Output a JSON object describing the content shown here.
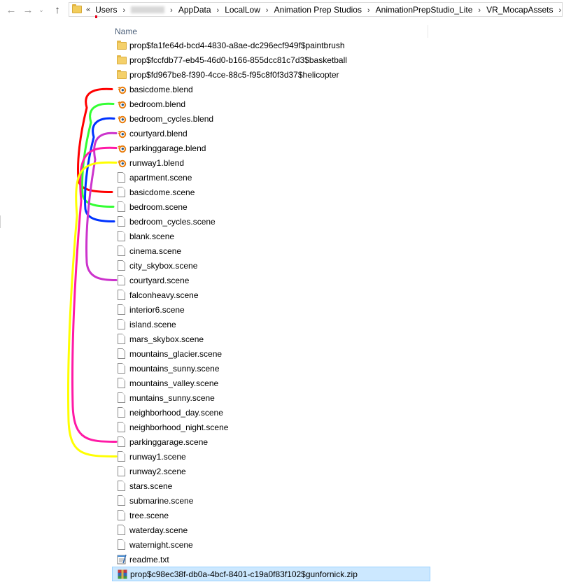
{
  "breadcrumb": {
    "overflow": "«",
    "segments": [
      {
        "label": "Users",
        "blurred": false
      },
      {
        "label": "",
        "blurred": true
      },
      {
        "label": "AppData",
        "blurred": false
      },
      {
        "label": "LocalLow",
        "blurred": false
      },
      {
        "label": "Animation Prep Studios",
        "blurred": false
      },
      {
        "label": "AnimationPrepStudio_Lite",
        "blurred": false
      },
      {
        "label": "VR_MocapAssets",
        "blurred": false,
        "current": true
      }
    ]
  },
  "nav": {
    "back_icon": "←",
    "forward_icon": "→",
    "recent_icon": "⌄",
    "up_icon": "↑",
    "separator": "›"
  },
  "list": {
    "column_header": "Name",
    "files": [
      {
        "name": "prop$fa1fe64d-bcd4-4830-a8ae-dc296ecf949f$paintbrush",
        "type": "folder"
      },
      {
        "name": "prop$fccfdb77-eb45-46d0-b166-855dcc81c7d3$basketball",
        "type": "folder"
      },
      {
        "name": "prop$fd967be8-f390-4cce-88c5-f95c8f0f3d37$helicopter",
        "type": "folder"
      },
      {
        "name": "basicdome.blend",
        "type": "blend"
      },
      {
        "name": "bedroom.blend",
        "type": "blend"
      },
      {
        "name": "bedroom_cycles.blend",
        "type": "blend"
      },
      {
        "name": "courtyard.blend",
        "type": "blend"
      },
      {
        "name": "parkinggarage.blend",
        "type": "blend"
      },
      {
        "name": "runway1.blend",
        "type": "blend"
      },
      {
        "name": "apartment.scene",
        "type": "file"
      },
      {
        "name": "basicdome.scene",
        "type": "file"
      },
      {
        "name": "bedroom.scene",
        "type": "file"
      },
      {
        "name": "bedroom_cycles.scene",
        "type": "file"
      },
      {
        "name": "blank.scene",
        "type": "file"
      },
      {
        "name": "cinema.scene",
        "type": "file"
      },
      {
        "name": "city_skybox.scene",
        "type": "file"
      },
      {
        "name": "courtyard.scene",
        "type": "file"
      },
      {
        "name": "falconheavy.scene",
        "type": "file"
      },
      {
        "name": "interior6.scene",
        "type": "file"
      },
      {
        "name": "island.scene",
        "type": "file"
      },
      {
        "name": "mars_skybox.scene",
        "type": "file"
      },
      {
        "name": "mountains_glacier.scene",
        "type": "file"
      },
      {
        "name": "mountains_sunny.scene",
        "type": "file"
      },
      {
        "name": "mountains_valley.scene",
        "type": "file"
      },
      {
        "name": "muntains_sunny.scene",
        "type": "file"
      },
      {
        "name": "neighborhood_day.scene",
        "type": "file"
      },
      {
        "name": "neighborhood_night.scene",
        "type": "file"
      },
      {
        "name": "parkinggarage.scene",
        "type": "file"
      },
      {
        "name": "runway1.scene",
        "type": "file"
      },
      {
        "name": "runway2.scene",
        "type": "file"
      },
      {
        "name": "stars.scene",
        "type": "file"
      },
      {
        "name": "submarine.scene",
        "type": "file"
      },
      {
        "name": "tree.scene",
        "type": "file"
      },
      {
        "name": "waterday.scene",
        "type": "file"
      },
      {
        "name": "waternight.scene",
        "type": "file"
      },
      {
        "name": "readme.txt",
        "type": "txt"
      },
      {
        "name": "prop$c98ec38f-db0a-4bcf-8401-c19a0f83f102$gunfornick.zip",
        "type": "zip",
        "selected": true
      }
    ]
  },
  "annotations": {
    "links": [
      {
        "from": "basicdome.blend",
        "to": "basicdome.scene",
        "color": "#ff0000"
      },
      {
        "from": "bedroom.blend",
        "to": "bedroom.scene",
        "color": "#33ff33"
      },
      {
        "from": "bedroom_cycles.blend",
        "to": "bedroom_cycles.scene",
        "color": "#0033ff"
      },
      {
        "from": "courtyard.blend",
        "to": "courtyard.scene",
        "color": "#cc33cc"
      },
      {
        "from": "parkinggarage.blend",
        "to": "parkinggarage.scene",
        "color": "#ff1aa6"
      },
      {
        "from": "runway1.blend",
        "to": "runway1.scene",
        "color": "#ffff00"
      }
    ],
    "underline_color": "#e8001c"
  }
}
